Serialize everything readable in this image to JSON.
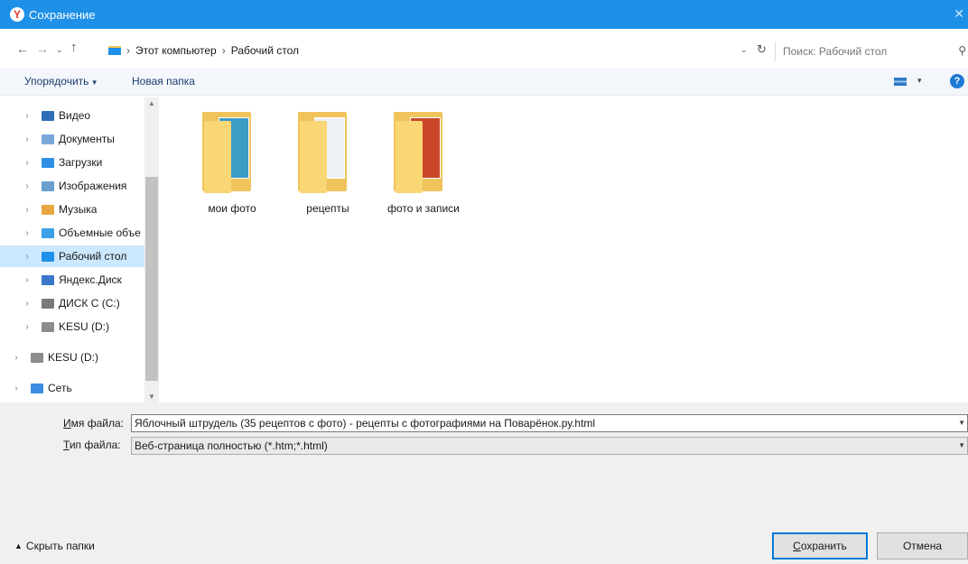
{
  "window": {
    "title": "Сохранение",
    "close_icon": "close-icon"
  },
  "address": {
    "crumbs": [
      "Этот компьютер",
      "Рабочий стол"
    ],
    "search_placeholder": "Поиск: Рабочий стол"
  },
  "toolbar": {
    "organize_label": "Упорядочить",
    "new_folder_label": "Новая папка"
  },
  "nav": {
    "items": [
      {
        "label": "Видео",
        "color": "#2f6fb7",
        "selected": false
      },
      {
        "label": "Документы",
        "color": "#7aa7d8",
        "selected": false
      },
      {
        "label": "Загрузки",
        "color": "#2f8fe3",
        "selected": false
      },
      {
        "label": "Изображения",
        "color": "#6aa0d0",
        "selected": false
      },
      {
        "label": "Музыка",
        "color": "#e8a640",
        "selected": false
      },
      {
        "label": "Объемные объе",
        "color": "#3aa0e8",
        "selected": false
      },
      {
        "label": "Рабочий стол",
        "color": "#1e90e8",
        "selected": true
      },
      {
        "label": "Яндекс.Диск",
        "color": "#3877c9",
        "selected": false
      },
      {
        "label": "ДИСК C (C:)",
        "color": "#7a7a7a",
        "selected": false
      },
      {
        "label": "KESU (D:)",
        "color": "#8c8c8c",
        "selected": false
      },
      {
        "label": "KESU (D:)",
        "color": "#8c8c8c",
        "selected": false
      },
      {
        "label": "Сеть",
        "color": "#3a8de0",
        "selected": false
      }
    ]
  },
  "folders": [
    {
      "name": "мои фото",
      "pic_color": "#3d9cc4"
    },
    {
      "name": "рецепты",
      "pic_color": "#eef1f6"
    },
    {
      "name": "фото и записи",
      "pic_color": "#c9462b"
    }
  ],
  "form": {
    "filename_label_u": "И",
    "filename_label_rest": "мя файла:",
    "filename_value": "Яблочный штрудель (35 рецептов с фото) - рецепты с фотографиями на Поварёнок.ру.html",
    "filetype_label_u": "Т",
    "filetype_label_rest": "ип файла:",
    "filetype_value": "Веб-страница полностью (*.htm;*.html)"
  },
  "footer": {
    "hide_folders_label": "Скрыть папки",
    "save_label_u": "С",
    "save_label_rest": "охранить",
    "cancel_label": "Отмена"
  }
}
